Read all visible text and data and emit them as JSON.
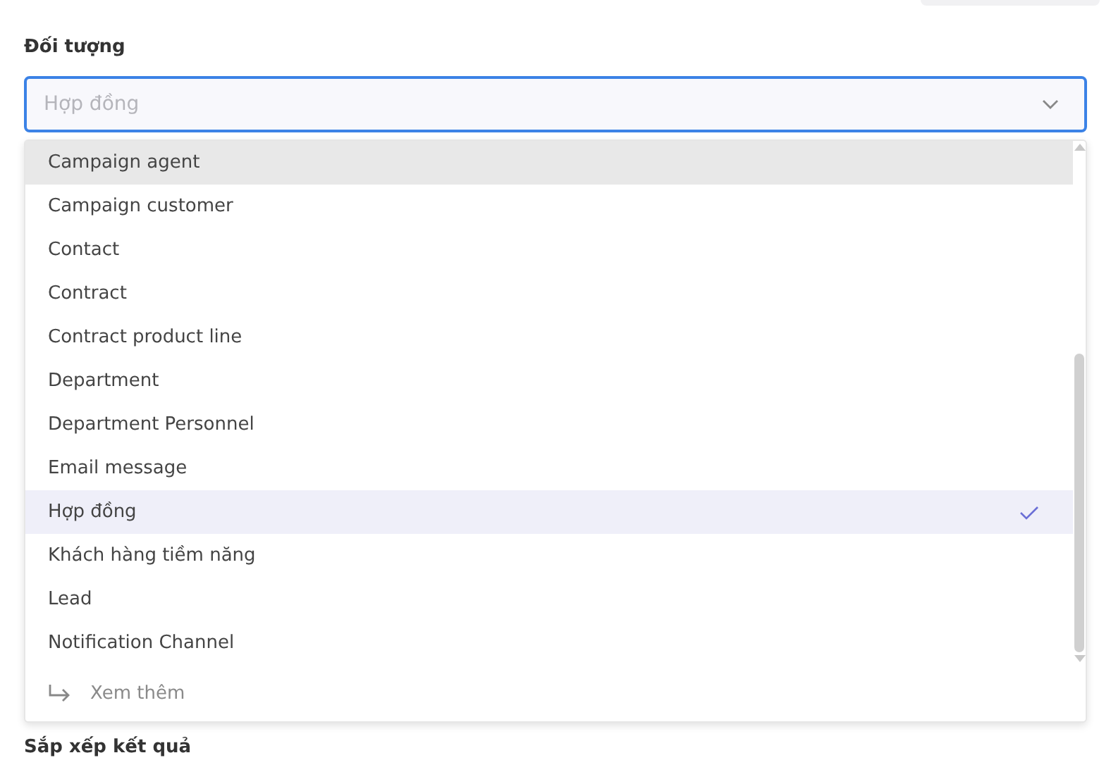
{
  "field": {
    "label": "Đối tượng",
    "placeholder": "Hợp đồng",
    "expanded": true
  },
  "options": [
    {
      "label": "Campaign agent",
      "hovered": true,
      "selected": false
    },
    {
      "label": "Campaign customer",
      "hovered": false,
      "selected": false
    },
    {
      "label": "Contact",
      "hovered": false,
      "selected": false
    },
    {
      "label": "Contract",
      "hovered": false,
      "selected": false
    },
    {
      "label": "Contract product line",
      "hovered": false,
      "selected": false
    },
    {
      "label": "Department",
      "hovered": false,
      "selected": false
    },
    {
      "label": "Department Personnel",
      "hovered": false,
      "selected": false
    },
    {
      "label": "Email message",
      "hovered": false,
      "selected": false
    },
    {
      "label": "Hợp đồng",
      "hovered": false,
      "selected": true
    },
    {
      "label": "Khách hàng tiềm năng",
      "hovered": false,
      "selected": false
    },
    {
      "label": "Lead",
      "hovered": false,
      "selected": false
    },
    {
      "label": "Notification Channel",
      "hovered": false,
      "selected": false
    }
  ],
  "more": {
    "label": "Xem thêm"
  },
  "next_section": {
    "label": "Sắp xếp kết quả"
  }
}
